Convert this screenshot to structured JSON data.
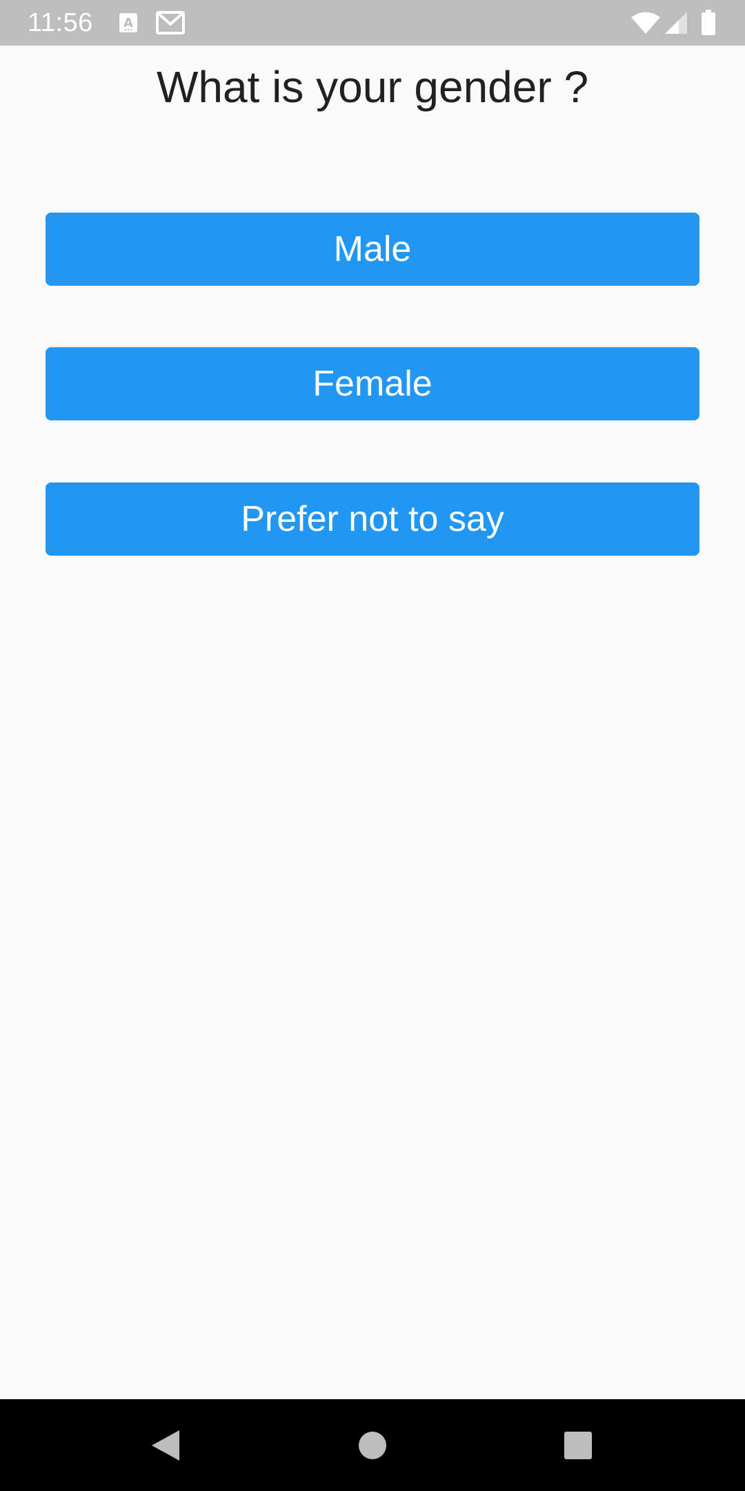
{
  "status_bar": {
    "time": "11:56",
    "background_color": "#bdbdbd",
    "icons": [
      "a11y-font-icon",
      "gmail-icon",
      "wifi-icon",
      "cellular-signal-icon",
      "battery-icon"
    ]
  },
  "question": {
    "title": "What is your gender ?"
  },
  "options": {
    "accent_color": "#2196f3",
    "male_label": "Male",
    "female_label": "Female",
    "prefer_not_label": "Prefer not to say"
  },
  "nav_bar": {
    "icons": [
      "back-icon",
      "home-icon",
      "recents-icon"
    ]
  }
}
